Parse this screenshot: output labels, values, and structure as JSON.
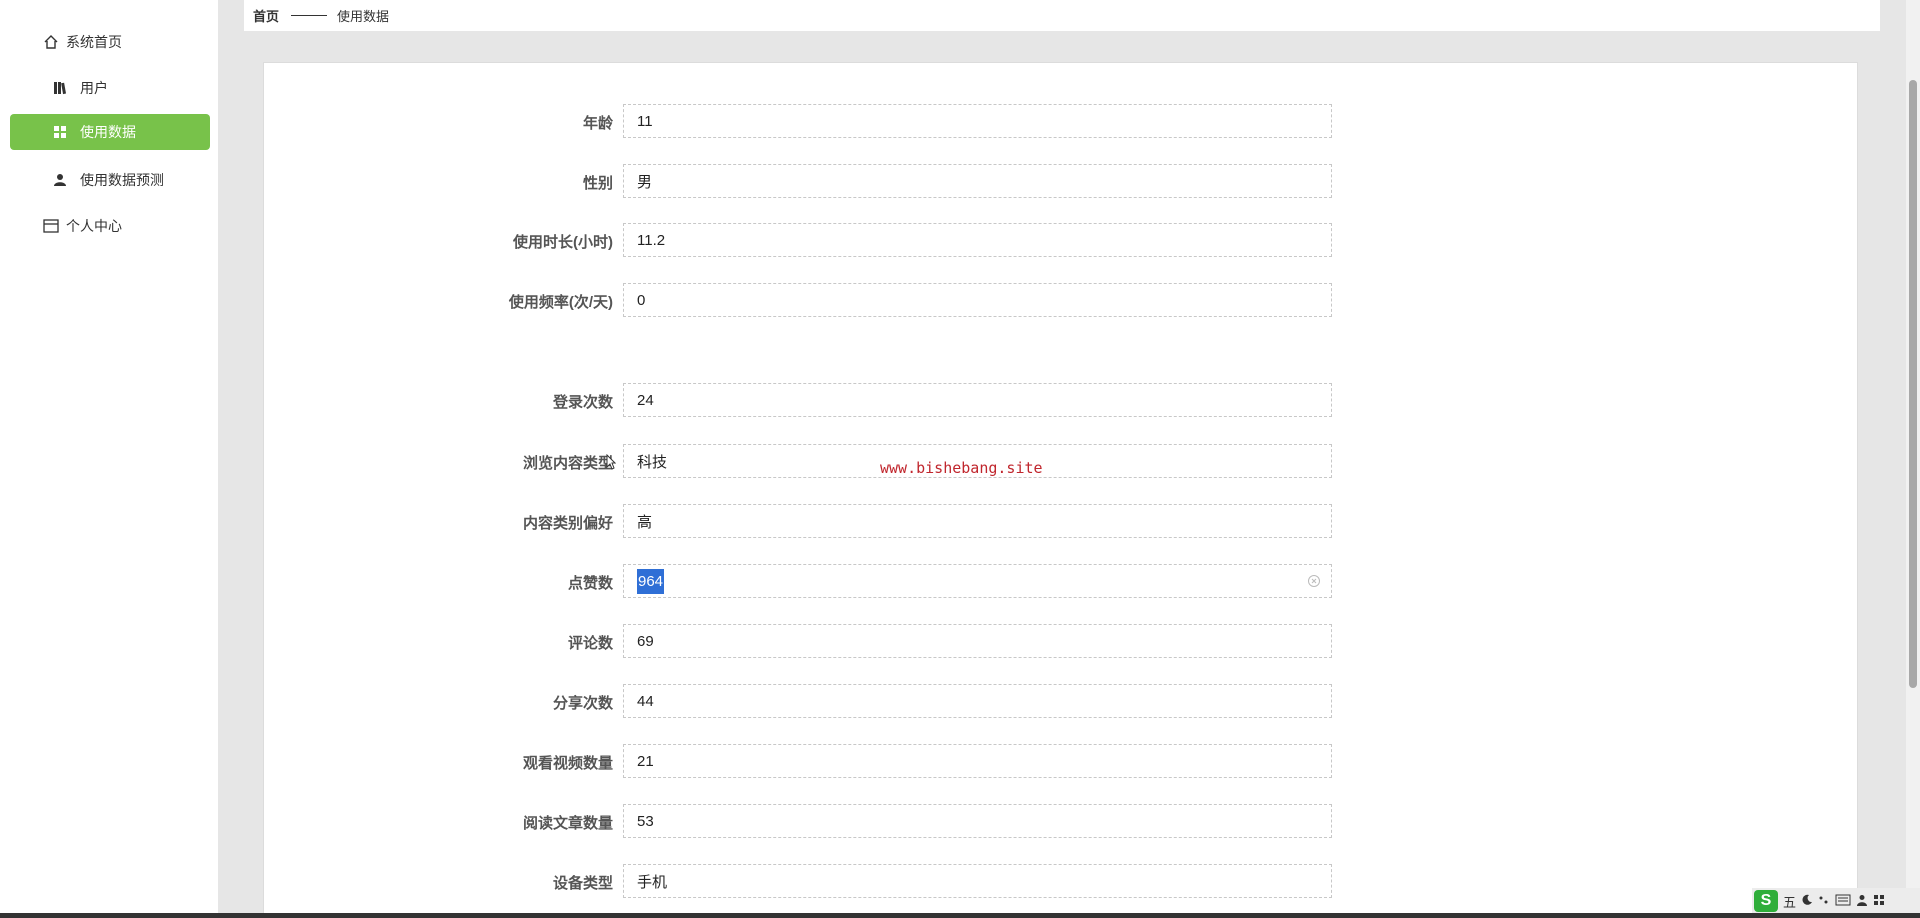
{
  "sidebar": {
    "items": [
      {
        "label": "系统首页",
        "icon": "home-icon",
        "active": false
      },
      {
        "label": "用户",
        "icon": "book-icon",
        "active": false
      },
      {
        "label": "使用数据",
        "icon": "grid-icon",
        "active": true
      },
      {
        "label": "使用数据预测",
        "icon": "user-icon",
        "active": false
      },
      {
        "label": "个人中心",
        "icon": "card-icon",
        "active": false
      }
    ]
  },
  "breadcrumb": {
    "home": "首页",
    "current": "使用数据"
  },
  "form": {
    "fields": [
      {
        "label": "年龄",
        "value": "11"
      },
      {
        "label": "性别",
        "value": "男"
      },
      {
        "label": "使用时长(小时)",
        "value": "11.2"
      },
      {
        "label": "使用频率(次/天)",
        "value": "0"
      },
      {
        "label": "登录次数",
        "value": "24"
      },
      {
        "label": "浏览内容类型",
        "value": "科技"
      },
      {
        "label": "内容类别偏好",
        "value": "高"
      },
      {
        "label": "点赞数",
        "value": "964",
        "selected": true
      },
      {
        "label": "评论数",
        "value": "69"
      },
      {
        "label": "分享次数",
        "value": "44"
      },
      {
        "label": "观看视频数量",
        "value": "21"
      },
      {
        "label": "阅读文章数量",
        "value": "53"
      },
      {
        "label": "设备类型",
        "value": "手机"
      }
    ]
  },
  "watermark": "www.bishebang.site",
  "ime": {
    "mode": "五",
    "icons": [
      "moon-icon",
      "punctuation-icon",
      "keyboard-icon",
      "user-icon",
      "settings-icon"
    ]
  },
  "colors": {
    "accent": "#78c24a",
    "selection": "#2f6fd6",
    "watermark": "#c0262d"
  }
}
